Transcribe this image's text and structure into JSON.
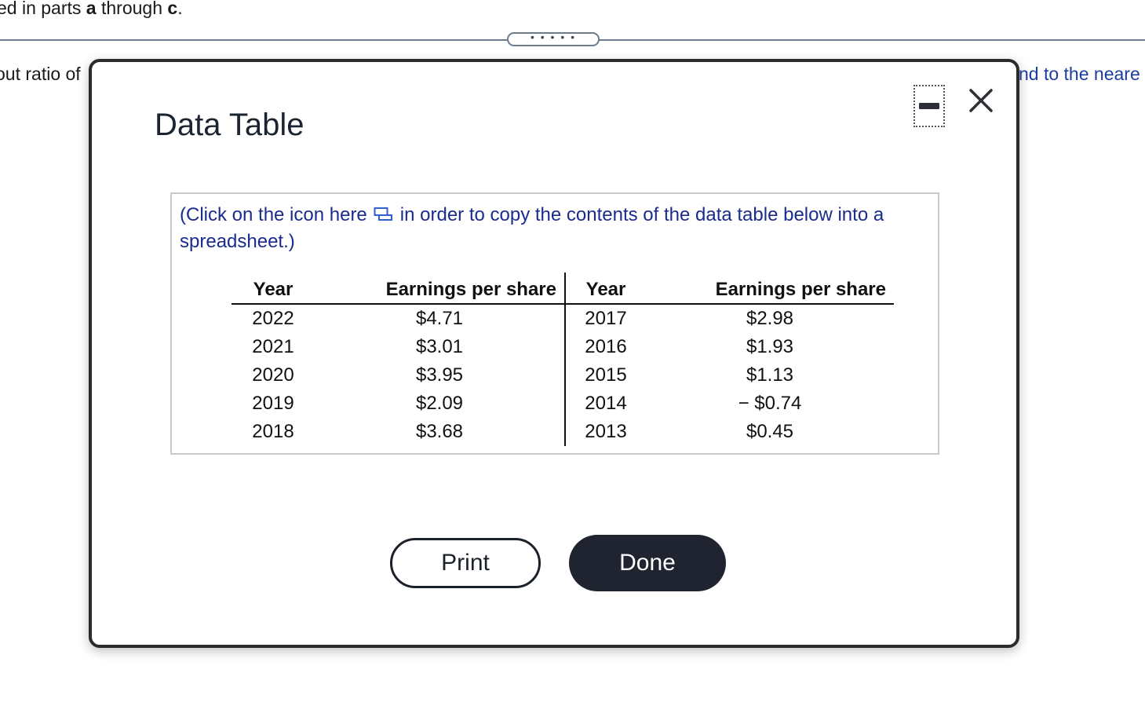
{
  "background": {
    "top_text_prefix": "ed in parts ",
    "top_text_a": "a",
    "top_text_mid": " through ",
    "top_text_c": "c",
    "top_text_end": ".",
    "handle_dots": "• • • • •",
    "left_text": "out ratio of",
    "right_text": "nd to the neare"
  },
  "modal": {
    "title": "Data Table",
    "info_text_before": "(Click on the icon here",
    "info_text_after": "in order to copy the contents of the data table below into a spreadsheet.)",
    "table": {
      "headers": [
        "Year",
        "Earnings per share",
        "Year",
        "Earnings per share"
      ],
      "rows": [
        [
          "2022",
          "$4.71",
          "2017",
          "$2.98"
        ],
        [
          "2021",
          "$3.01",
          "2016",
          "$1.93"
        ],
        [
          "2020",
          "$3.95",
          "2015",
          "$1.13"
        ],
        [
          "2019",
          "$2.09",
          "2014",
          "− $0.74"
        ],
        [
          "2018",
          "$3.68",
          "2013",
          "$0.45"
        ]
      ]
    },
    "print_label": "Print",
    "done_label": "Done"
  },
  "icons": {
    "minimize": "minimize-icon",
    "close": "close-icon",
    "copy": "copy-spreadsheet-icon"
  },
  "colors": {
    "link_blue": "#1a2c8c",
    "done_bg": "#1f2430"
  }
}
